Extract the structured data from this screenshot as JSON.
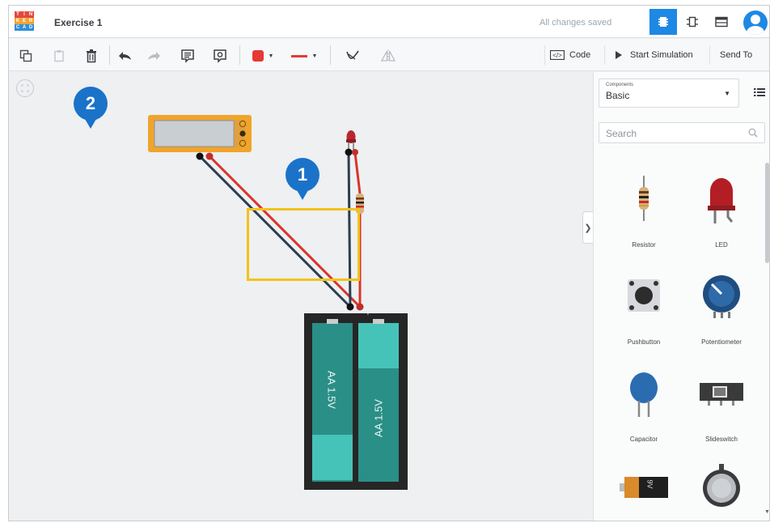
{
  "app": {
    "logo_letters": [
      "T",
      "I",
      "N",
      "K",
      "E",
      "R",
      "C",
      "A",
      "D"
    ],
    "title": "Exercise 1",
    "save_status": "All changes saved"
  },
  "view_buttons": [
    {
      "name": "circuit-view-icon",
      "active": true
    },
    {
      "name": "schematic-view-icon",
      "active": false
    },
    {
      "name": "component-list-icon",
      "active": false
    }
  ],
  "toolbar": {
    "code_label": "Code",
    "start_simulation_label": "Start Simulation",
    "send_to_label": "Send To",
    "fill_color": "#e53935",
    "wire_color": "#e53935"
  },
  "components_panel": {
    "select_label": "Components",
    "select_value": "Basic",
    "search_placeholder": "Search",
    "items": [
      {
        "label": "Resistor",
        "icon": "resistor-icon"
      },
      {
        "label": "LED",
        "icon": "led-icon"
      },
      {
        "label": "Pushbutton",
        "icon": "pushbutton-icon"
      },
      {
        "label": "Potentiometer",
        "icon": "potentiometer-icon"
      },
      {
        "label": "Capacitor",
        "icon": "capacitor-icon"
      },
      {
        "label": "Slideswitch",
        "icon": "slideswitch-icon"
      },
      {
        "label": "",
        "icon": "9v-battery-icon",
        "text": "9V"
      },
      {
        "label": "",
        "icon": "coin-cell-battery-icon"
      }
    ]
  },
  "canvas": {
    "battery_cells": [
      "AA 1.5V",
      "AA 1.5V"
    ],
    "battery_terminals": {
      "minus": "−",
      "plus": "+"
    }
  },
  "callouts": [
    {
      "number": "1"
    },
    {
      "number": "2"
    }
  ],
  "colors": {
    "accent": "#1e88e5",
    "marker": "#1a73c9",
    "highlight": "#f2c21b",
    "multimeter": "#f0a42a",
    "battery_cell": "#2a8f87",
    "battery_cell_light": "#46c3b8"
  }
}
